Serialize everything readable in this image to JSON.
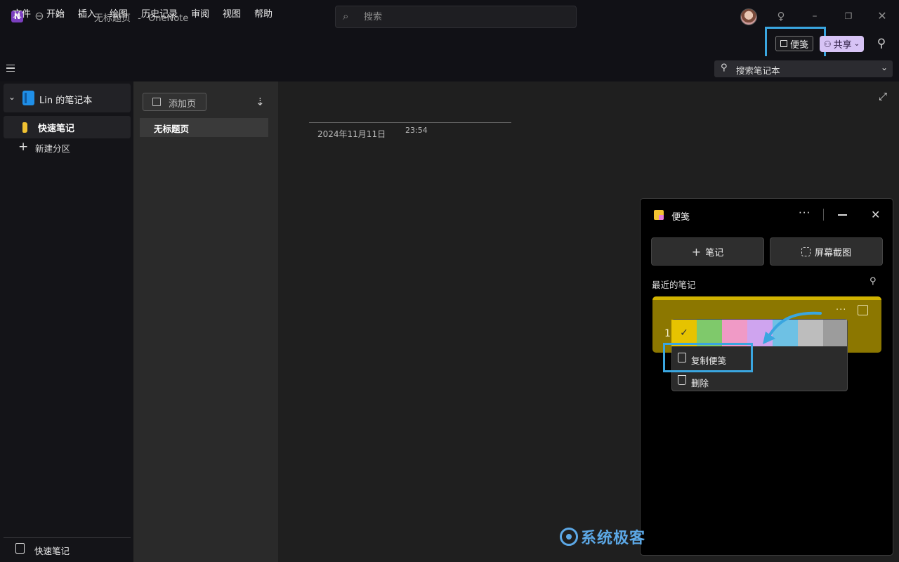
{
  "titlebar": {
    "app_icon_letter": "N",
    "doc_title": "无标题页",
    "separator": "-",
    "app_name": "OneNote",
    "search_placeholder": "搜索"
  },
  "menu": {
    "items": [
      "文件",
      "开始",
      "插入",
      "绘图",
      "历史记录",
      "审阅",
      "视图",
      "帮助"
    ],
    "sticky_notes_label": "便笺",
    "share_label": "共享"
  },
  "toolbar": {
    "notebook_search_label": "搜索笔记本"
  },
  "notebook": {
    "name": "Lin 的笔记本",
    "sections": [
      {
        "label": "快速笔记",
        "color": "#f1c232"
      }
    ],
    "new_section_label": "新建分区",
    "bottom_quick_notes_label": "快速笔记"
  },
  "pages": {
    "add_page_label": "添加页",
    "items": [
      "无标题页"
    ]
  },
  "page": {
    "date": "2024年11月11日",
    "time": "23:54"
  },
  "sticky_pane": {
    "title": "便笺",
    "new_note_label": "笔记",
    "screenshot_label": "屏幕截图",
    "recent_label": "最近的笔记",
    "note_text": "1",
    "note_color": "#8c7700",
    "color_swatches": [
      "#e6c300",
      "#7fc96b",
      "#f09ac6",
      "#cfa4ef",
      "#6ec1e4",
      "#bdbdbd",
      "#9c9c9c"
    ],
    "selected_swatch": 0,
    "context_menu": [
      "复制便笺",
      "删除"
    ]
  },
  "highlight_color": "#3aa6e0",
  "watermark": "系统极客"
}
